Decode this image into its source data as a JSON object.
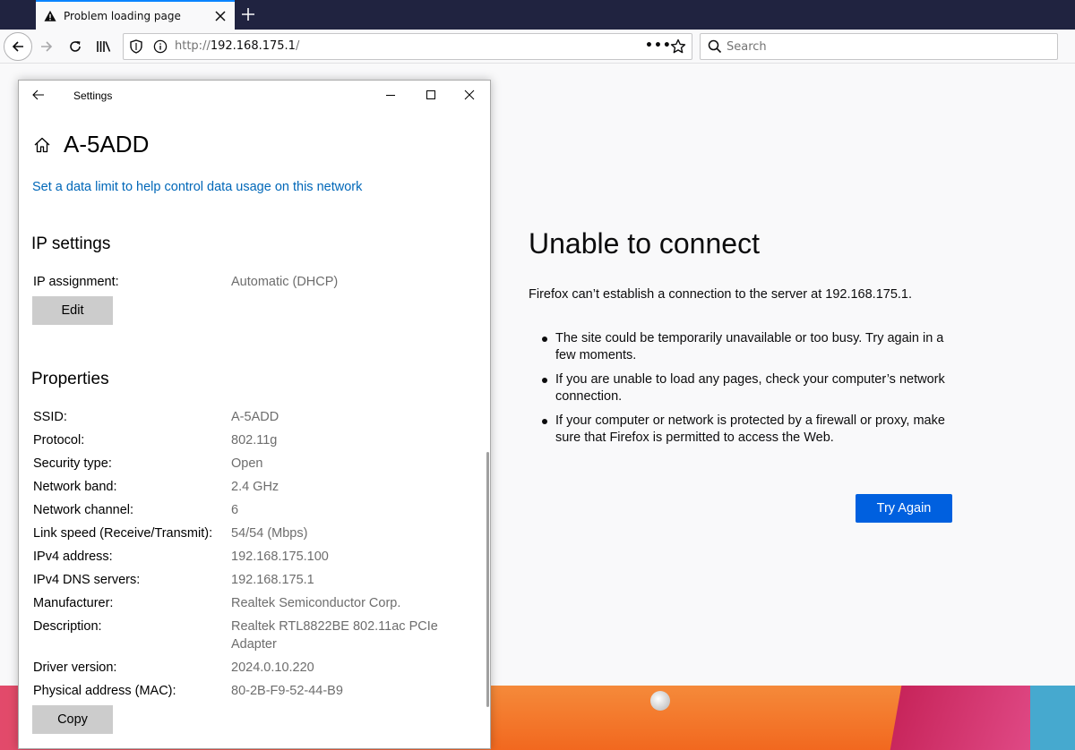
{
  "browser": {
    "tab_title": "Problem loading page",
    "url_scheme": "http://",
    "url_host": "192.168.175.1",
    "url_path": "/",
    "search_placeholder": "Search",
    "page_actions": "•••"
  },
  "error_page": {
    "title": "Unable to connect",
    "description": "Firefox can’t establish a connection to the server at 192.168.175.1.",
    "bullets": [
      "The site could be temporarily unavailable or too busy. Try again in a few moments.",
      "If you are unable to load any pages, check your computer’s network connection.",
      "If your computer or network is protected by a firewall or proxy, make sure that Firefox is permitted to access the Web."
    ],
    "try_again_label": "Try Again"
  },
  "settings": {
    "window_title": "Settings",
    "network_name": "A-5ADD",
    "data_limit_link": "Set a data limit to help control data usage on this network",
    "ip_section": {
      "heading": "IP settings",
      "assignment_label": "IP assignment:",
      "assignment_value": "Automatic (DHCP)",
      "edit_label": "Edit"
    },
    "properties": {
      "heading": "Properties",
      "rows": [
        {
          "label": "SSID:",
          "value": "A-5ADD"
        },
        {
          "label": "Protocol:",
          "value": "802.11g"
        },
        {
          "label": "Security type:",
          "value": "Open"
        },
        {
          "label": "Network band:",
          "value": "2.4 GHz"
        },
        {
          "label": "Network channel:",
          "value": "6"
        },
        {
          "label": "Link speed (Receive/Transmit):",
          "value": "54/54 (Mbps)"
        },
        {
          "label": "IPv4 address:",
          "value": "192.168.175.100"
        },
        {
          "label": "IPv4 DNS servers:",
          "value": "192.168.175.1"
        },
        {
          "label": "Manufacturer:",
          "value": "Realtek Semiconductor Corp."
        },
        {
          "label": "Description:",
          "value": "Realtek RTL8822BE 802.11ac PCIe Adapter"
        },
        {
          "label": "Driver version:",
          "value": "2024.0.10.220"
        },
        {
          "label": "Physical address (MAC):",
          "value": "80-2B-F9-52-44-B9"
        }
      ],
      "copy_label": "Copy"
    }
  },
  "colors": {
    "link_blue": "#0067b8",
    "firefox_button_blue": "#0060df",
    "tabbar_dark": "#202340"
  }
}
